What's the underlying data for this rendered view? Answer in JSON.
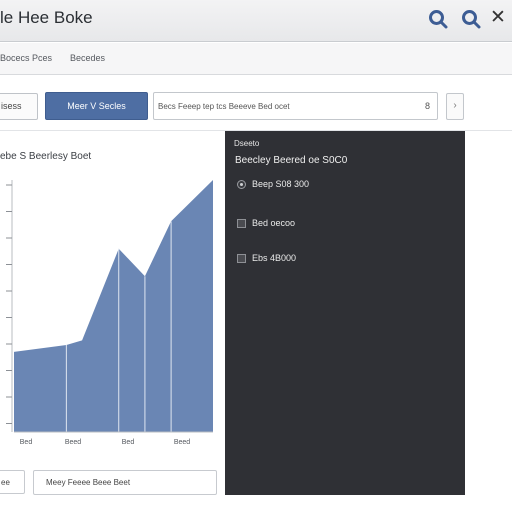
{
  "window": {
    "title": "le Hee Boke"
  },
  "tabs": [
    {
      "label": "Bocecs Pces"
    },
    {
      "label": "Becedes"
    }
  ],
  "toolbar": {
    "left_button": "isess",
    "primary_button": "Meer V Secles",
    "search_value": "Becs Feeep tep tcs Beeeve Bed ocet",
    "search_count": "8",
    "arrow_button": "›"
  },
  "chart_panel": {
    "title": "ebe S Beerlesy Boet"
  },
  "chart_data": {
    "type": "area",
    "categories": [
      "Bed",
      "Beed",
      "Bed",
      "Beed"
    ],
    "values": [
      [
        0,
        35
      ],
      [
        1,
        38
      ],
      [
        1.3,
        40
      ],
      [
        2,
        80
      ],
      [
        2.5,
        68
      ],
      [
        3.0,
        92
      ],
      [
        3.8,
        110
      ]
    ],
    "ylim": [
      0,
      110
    ],
    "color": "#6a86b4"
  },
  "bottom": {
    "button": "ee",
    "field": "Meey Feeee Beee Beet"
  },
  "side_panel": {
    "header": "Dseeto",
    "subtitle": "Beecley Beered oe S0C0",
    "options": [
      {
        "type": "radio",
        "label": "Beep S08 300"
      },
      {
        "type": "checkbox",
        "label": "Bed oecoo"
      },
      {
        "type": "checkbox",
        "label": "Ebs 4B000"
      }
    ]
  },
  "colors": {
    "accent": "#4e6ea3",
    "panel_dark": "#2f3035",
    "area_fill": "#6a86b4"
  },
  "icons": [
    "search-icon",
    "search-icon",
    "close-icon"
  ]
}
